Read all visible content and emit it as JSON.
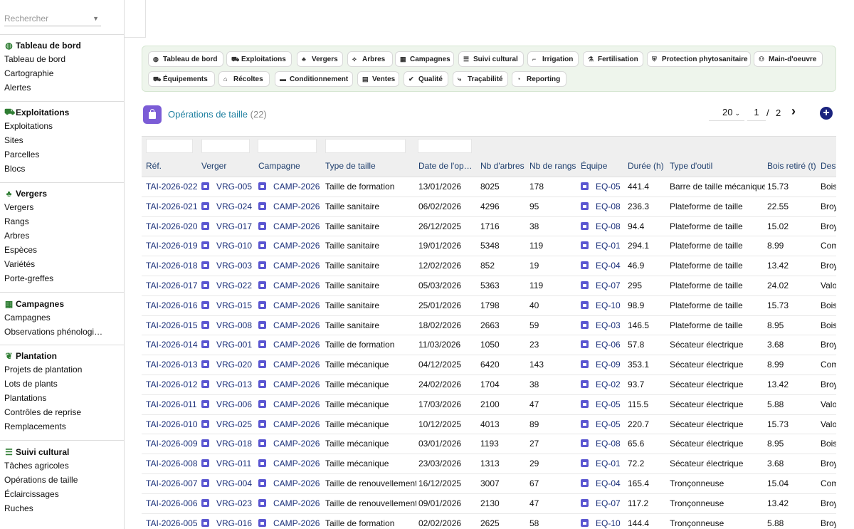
{
  "sidebar": {
    "search_placeholder": "Rechercher",
    "sections": [
      {
        "title": "Tableau de bord",
        "icon": "dashboard-icon",
        "glyph": "◍",
        "items": [
          "Tableau de bord",
          "Cartographie",
          "Alertes"
        ]
      },
      {
        "title": "Exploitations",
        "icon": "tractor-icon",
        "glyph": "⛟",
        "items": [
          "Exploitations",
          "Sites",
          "Parcelles",
          "Blocs"
        ]
      },
      {
        "title": "Vergers",
        "icon": "tree-icon",
        "glyph": "♣",
        "items": [
          "Vergers",
          "Rangs",
          "Arbres",
          "Espèces",
          "Variétés",
          "Porte-greffes"
        ]
      },
      {
        "title": "Campagnes",
        "icon": "calendar-icon",
        "glyph": "▦",
        "items": [
          "Campagnes",
          "Observations phénologiq…"
        ]
      },
      {
        "title": "Plantation",
        "icon": "seedling-icon",
        "glyph": "❦",
        "items": [
          "Projets de plantation",
          "Lots de plants",
          "Plantations",
          "Contrôles de reprise",
          "Remplacements"
        ]
      },
      {
        "title": "Suivi cultural",
        "icon": "list-check-icon",
        "glyph": "☰",
        "items": [
          "Tâches agricoles",
          "Opérations de taille",
          "Éclaircissages",
          "Ruches"
        ]
      }
    ]
  },
  "modules": [
    {
      "label": "Tableau de bord",
      "icon": "dashboard-icon",
      "glyph": "◍"
    },
    {
      "label": "Exploitations",
      "icon": "tractor-icon",
      "glyph": "⛟"
    },
    {
      "label": "Vergers",
      "icon": "tree-icon",
      "glyph": "♣"
    },
    {
      "label": "Arbres",
      "icon": "branch-icon",
      "glyph": "⟡"
    },
    {
      "label": "Campagnes",
      "icon": "calendar-icon",
      "glyph": "▦"
    },
    {
      "label": "Suivi cultural",
      "icon": "list-check-icon",
      "glyph": "☰"
    },
    {
      "label": "Irrigation",
      "icon": "faucet-icon",
      "glyph": "⌐"
    },
    {
      "label": "Fertilisation",
      "icon": "flask-icon",
      "glyph": "⚗"
    },
    {
      "label": "Protection phytosanitaire",
      "icon": "shield-icon",
      "glyph": "⛨"
    },
    {
      "label": "Main-d'oeuvre",
      "icon": "users-icon",
      "glyph": "⚇"
    },
    {
      "label": "Équipements",
      "icon": "tractor-icon",
      "glyph": "⛟"
    },
    {
      "label": "Récoltes",
      "icon": "basket-icon",
      "glyph": "⌂"
    },
    {
      "label": "Conditionnement",
      "icon": "box-icon",
      "glyph": "▬"
    },
    {
      "label": "Ventes",
      "icon": "receipt-icon",
      "glyph": "▤"
    },
    {
      "label": "Qualité",
      "icon": "check-double-icon",
      "glyph": "✔"
    },
    {
      "label": "Traçabilité",
      "icon": "route-icon",
      "glyph": "⤷"
    },
    {
      "label": "Reporting",
      "icon": "chart-pie-icon",
      "glyph": "◔"
    }
  ],
  "header": {
    "title": "Opérations de taille",
    "count": "(22)",
    "page_size": "20",
    "page_current": "1",
    "page_sep": "/",
    "page_total": "2",
    "next_glyph": "›",
    "add_glyph": "+"
  },
  "table": {
    "columns": [
      "Réf.",
      "Verger",
      "Campagne",
      "Type de taille",
      "Date de l'op…",
      "Nb d'arbres",
      "Nb de rangs",
      "Équipe",
      "Durée (h)",
      "Type d'outil",
      "Bois retiré (t)",
      "Dest"
    ],
    "rows": [
      [
        "TAI-2026-022",
        "VRG-005",
        "CAMP-2026",
        "Taille de formation",
        "13/01/2026",
        "8025",
        "178",
        "EQ-05",
        "441.4",
        "Barre de taille mécanique",
        "15.73",
        "Bois"
      ],
      [
        "TAI-2026-021",
        "VRG-024",
        "CAMP-2026",
        "Taille sanitaire",
        "06/02/2026",
        "4296",
        "95",
        "EQ-08",
        "236.3",
        "Plateforme de taille",
        "22.55",
        "Broy"
      ],
      [
        "TAI-2026-020",
        "VRG-017",
        "CAMP-2026",
        "Taille sanitaire",
        "26/12/2025",
        "1716",
        "38",
        "EQ-08",
        "94.4",
        "Plateforme de taille",
        "15.02",
        "Broy"
      ],
      [
        "TAI-2026-019",
        "VRG-010",
        "CAMP-2026",
        "Taille sanitaire",
        "19/01/2026",
        "5348",
        "119",
        "EQ-01",
        "294.1",
        "Plateforme de taille",
        "8.99",
        "Com"
      ],
      [
        "TAI-2026-018",
        "VRG-003",
        "CAMP-2026",
        "Taille sanitaire",
        "12/02/2026",
        "852",
        "19",
        "EQ-04",
        "46.9",
        "Plateforme de taille",
        "13.42",
        "Broy"
      ],
      [
        "TAI-2026-017",
        "VRG-022",
        "CAMP-2026",
        "Taille sanitaire",
        "05/03/2026",
        "5363",
        "119",
        "EQ-07",
        "295",
        "Plateforme de taille",
        "24.02",
        "Valo"
      ],
      [
        "TAI-2026-016",
        "VRG-015",
        "CAMP-2026",
        "Taille sanitaire",
        "25/01/2026",
        "1798",
        "40",
        "EQ-10",
        "98.9",
        "Plateforme de taille",
        "15.73",
        "Bois"
      ],
      [
        "TAI-2026-015",
        "VRG-008",
        "CAMP-2026",
        "Taille sanitaire",
        "18/02/2026",
        "2663",
        "59",
        "EQ-03",
        "146.5",
        "Plateforme de taille",
        "8.95",
        "Bois"
      ],
      [
        "TAI-2026-014",
        "VRG-001",
        "CAMP-2026",
        "Taille de formation",
        "11/03/2026",
        "1050",
        "23",
        "EQ-06",
        "57.8",
        "Sécateur électrique",
        "3.68",
        "Broy"
      ],
      [
        "TAI-2026-013",
        "VRG-020",
        "CAMP-2026",
        "Taille mécanique",
        "04/12/2025",
        "6420",
        "143",
        "EQ-09",
        "353.1",
        "Sécateur électrique",
        "8.99",
        "Com"
      ],
      [
        "TAI-2026-012",
        "VRG-013",
        "CAMP-2026",
        "Taille mécanique",
        "24/02/2026",
        "1704",
        "38",
        "EQ-02",
        "93.7",
        "Sécateur électrique",
        "13.42",
        "Broy"
      ],
      [
        "TAI-2026-011",
        "VRG-006",
        "CAMP-2026",
        "Taille mécanique",
        "17/03/2026",
        "2100",
        "47",
        "EQ-05",
        "115.5",
        "Sécateur électrique",
        "5.88",
        "Valo"
      ],
      [
        "TAI-2026-010",
        "VRG-025",
        "CAMP-2026",
        "Taille mécanique",
        "10/12/2025",
        "4013",
        "89",
        "EQ-05",
        "220.7",
        "Sécateur électrique",
        "15.73",
        "Valo"
      ],
      [
        "TAI-2026-009",
        "VRG-018",
        "CAMP-2026",
        "Taille mécanique",
        "03/01/2026",
        "1193",
        "27",
        "EQ-08",
        "65.6",
        "Sécateur électrique",
        "8.95",
        "Bois"
      ],
      [
        "TAI-2026-008",
        "VRG-011",
        "CAMP-2026",
        "Taille mécanique",
        "23/03/2026",
        "1313",
        "29",
        "EQ-01",
        "72.2",
        "Sécateur électrique",
        "3.68",
        "Broy"
      ],
      [
        "TAI-2026-007",
        "VRG-004",
        "CAMP-2026",
        "Taille de renouvellement",
        "16/12/2025",
        "3007",
        "67",
        "EQ-04",
        "165.4",
        "Tronçonneuse",
        "15.04",
        "Com"
      ],
      [
        "TAI-2026-006",
        "VRG-023",
        "CAMP-2026",
        "Taille de renouvellement",
        "09/01/2026",
        "2130",
        "47",
        "EQ-07",
        "117.2",
        "Tronçonneuse",
        "13.42",
        "Broy"
      ],
      [
        "TAI-2026-005",
        "VRG-016",
        "CAMP-2026",
        "Taille de formation",
        "02/02/2026",
        "2625",
        "58",
        "EQ-10",
        "144.4",
        "Tronçonneuse",
        "5.88",
        "Broy"
      ]
    ]
  }
}
